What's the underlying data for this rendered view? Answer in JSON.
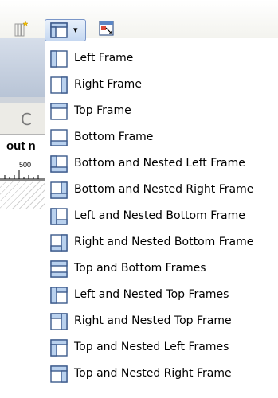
{
  "toolbar": {
    "new_icon": "new-document-sparkle-icon",
    "frames_button_icon": "frame-layout-icon",
    "frames_caret": "▾",
    "target_icon": "target-frame-icon"
  },
  "background": {
    "refresh_glyph": "C",
    "label": "out n",
    "ruler_value": "500"
  },
  "menu": {
    "items": [
      {
        "label": "Left Frame",
        "icon": "left-frame-icon"
      },
      {
        "label": "Right Frame",
        "icon": "right-frame-icon"
      },
      {
        "label": "Top Frame",
        "icon": "top-frame-icon"
      },
      {
        "label": "Bottom Frame",
        "icon": "bottom-frame-icon"
      },
      {
        "label": "Bottom and Nested Left Frame",
        "icon": "bottom-nested-left-frame-icon"
      },
      {
        "label": "Bottom and Nested Right Frame",
        "icon": "bottom-nested-right-frame-icon"
      },
      {
        "label": "Left and Nested Bottom Frame",
        "icon": "left-nested-bottom-frame-icon"
      },
      {
        "label": "Right and Nested Bottom Frame",
        "icon": "right-nested-bottom-frame-icon"
      },
      {
        "label": "Top and Bottom Frames",
        "icon": "top-bottom-frames-icon"
      },
      {
        "label": "Left and Nested Top Frames",
        "icon": "left-nested-top-frames-icon"
      },
      {
        "label": "Right and Nested Top Frame",
        "icon": "right-nested-top-frame-icon"
      },
      {
        "label": "Top and Nested Left Frames",
        "icon": "top-nested-left-frames-icon"
      },
      {
        "label": "Top and Nested Right Frame",
        "icon": "top-nested-right-frame-icon"
      }
    ]
  },
  "colors": {
    "frame_fill": "#b9d1ee",
    "frame_border": "#3c5a8c",
    "menu_border": "#8c8c8c"
  }
}
